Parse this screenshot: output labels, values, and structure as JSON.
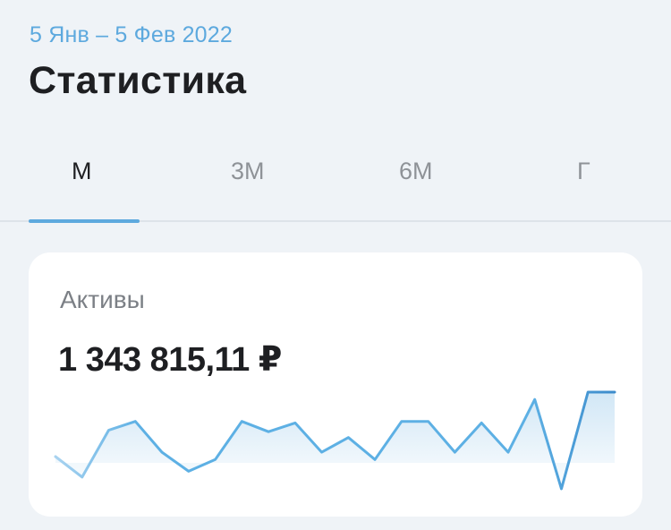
{
  "header": {
    "date_range": "5 Янв – 5 Фев 2022",
    "title": "Статистика"
  },
  "tabs": [
    {
      "label": "М",
      "active": true
    },
    {
      "label": "3М",
      "active": false
    },
    {
      "label": "6М",
      "active": false
    },
    {
      "label": "Г",
      "active": false
    }
  ],
  "card": {
    "title": "Активы",
    "value": "1 343 815,11 ₽"
  },
  "colors": {
    "accent": "#5DA9DE",
    "background": "#EFF3F7",
    "card": "#FFFFFF",
    "text": "#1E1F22",
    "muted": "#8E9297"
  },
  "chart_data": {
    "type": "area",
    "title": "",
    "xlabel": "",
    "ylabel": "",
    "grid": false,
    "values": [
      52,
      38,
      70,
      76,
      55,
      42,
      50,
      76,
      69,
      75,
      55,
      65,
      50,
      76,
      76,
      55,
      75,
      55,
      91,
      30,
      96,
      96
    ],
    "ylim": [
      30,
      96
    ]
  }
}
